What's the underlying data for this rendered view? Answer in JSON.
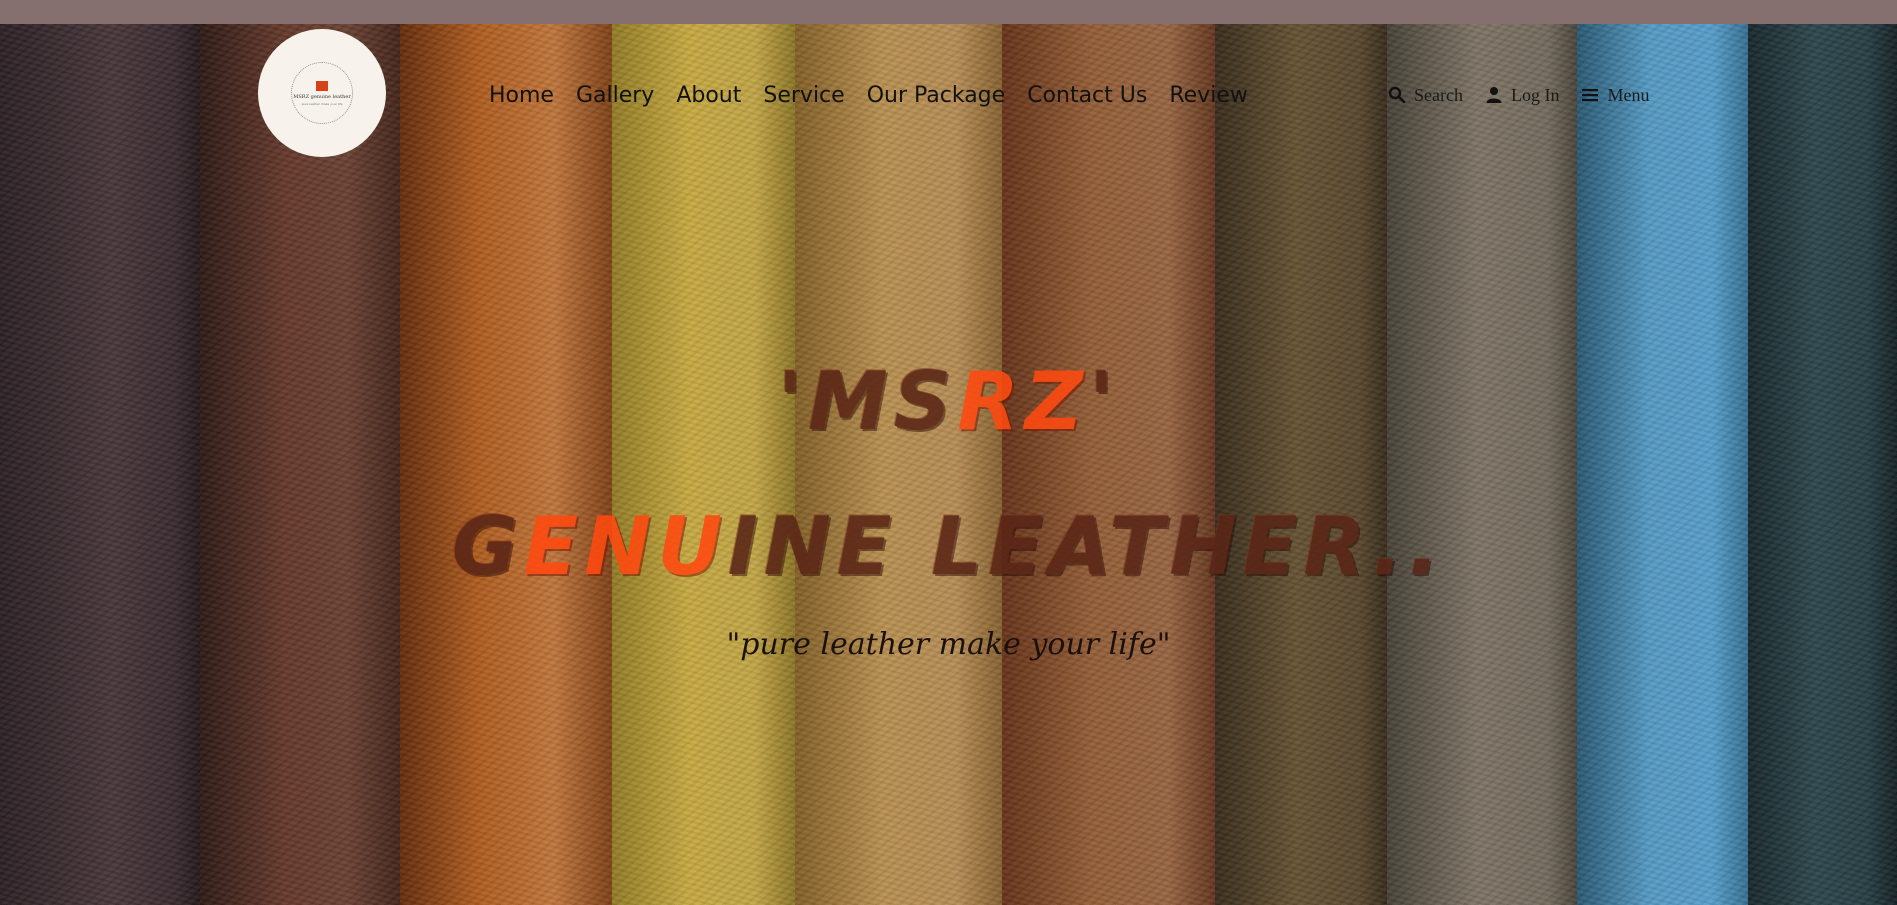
{
  "brand": {
    "logo_text": "MSRZ genuine leather",
    "logo_subtext": "pure leather make your life"
  },
  "nav": {
    "items": [
      {
        "label": "Home"
      },
      {
        "label": "Gallery"
      },
      {
        "label": "About"
      },
      {
        "label": "Service"
      },
      {
        "label": "Our Package"
      },
      {
        "label": "Contact Us"
      },
      {
        "label": "Review"
      }
    ]
  },
  "utilities": {
    "search_label": "Search",
    "search_icon": "search-icon",
    "login_label": "Log In",
    "login_icon": "user-icon",
    "menu_label": "Menu",
    "menu_icon": "hamburger-icon"
  },
  "hero": {
    "headline_1_pre": "'MS",
    "headline_1_accent": "RZ",
    "headline_1_post": "'",
    "headline_2_pre": "G",
    "headline_2_accent": "ENU",
    "headline_2_post": "INE LEATHER..",
    "tagline": "\"pure leather make your life\""
  },
  "colors": {
    "topbar": "#86706f",
    "accent": "#ff4a10",
    "headline": "#5a2516",
    "logo_bg": "#f7f3ec"
  }
}
